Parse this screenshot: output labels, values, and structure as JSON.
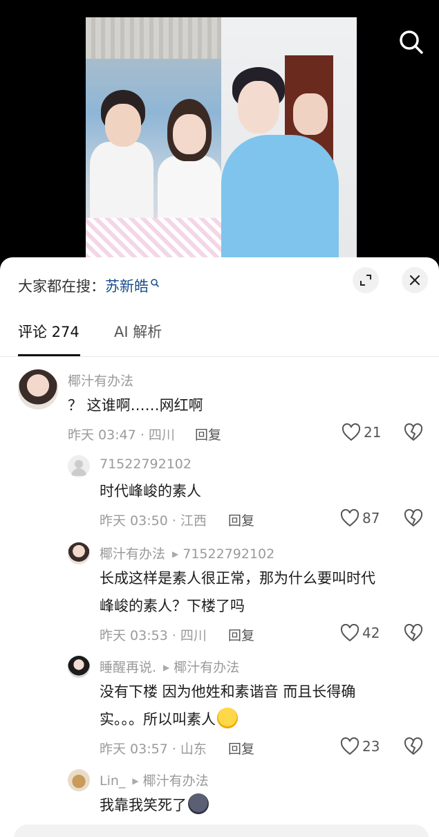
{
  "header": {
    "search_prefix": "大家都在搜：",
    "search_term": "苏新皓"
  },
  "tabs": [
    {
      "label": "评论 274"
    },
    {
      "label": "AI 解析"
    }
  ],
  "comments": [
    {
      "user": "椰汁有办法",
      "text": "？ 这谁啊……网红啊",
      "meta": "昨天 03:47 · 四川",
      "reply_label": "回复",
      "likes": "21"
    },
    {
      "user": "71522792102",
      "text": "时代峰峻的素人",
      "meta": "昨天 03:50 · 江西",
      "reply_label": "回复",
      "likes": "87"
    },
    {
      "user": "椰汁有办法",
      "reply_to": "71522792102",
      "text_line1": "长成这样是素人很正常，那为什么要叫时代",
      "text_line2": "峰峻的素人？下楼了吗",
      "meta": "昨天 03:53 · 四川",
      "reply_label": "回复",
      "likes": "42"
    },
    {
      "user": "睡醒再说.",
      "reply_to": "椰汁有办法",
      "text_line1": "没有下楼 因为他姓和素谐音 而且长得确",
      "text_line2": "实。。。所以叫素人",
      "meta": "昨天 03:57 · 山东",
      "reply_label": "回复",
      "likes": "23"
    },
    {
      "user": "Lin_",
      "reply_to": "椰汁有办法",
      "text": "我靠我笑死了"
    }
  ],
  "colors": {
    "link_blue": "#1a4d8f",
    "muted_gray": "#9a9a9a"
  },
  "icons": [
    "search-icon",
    "expand-icon",
    "close-icon",
    "heart-icon",
    "broken-heart-icon",
    "reply-arrow-icon"
  ]
}
